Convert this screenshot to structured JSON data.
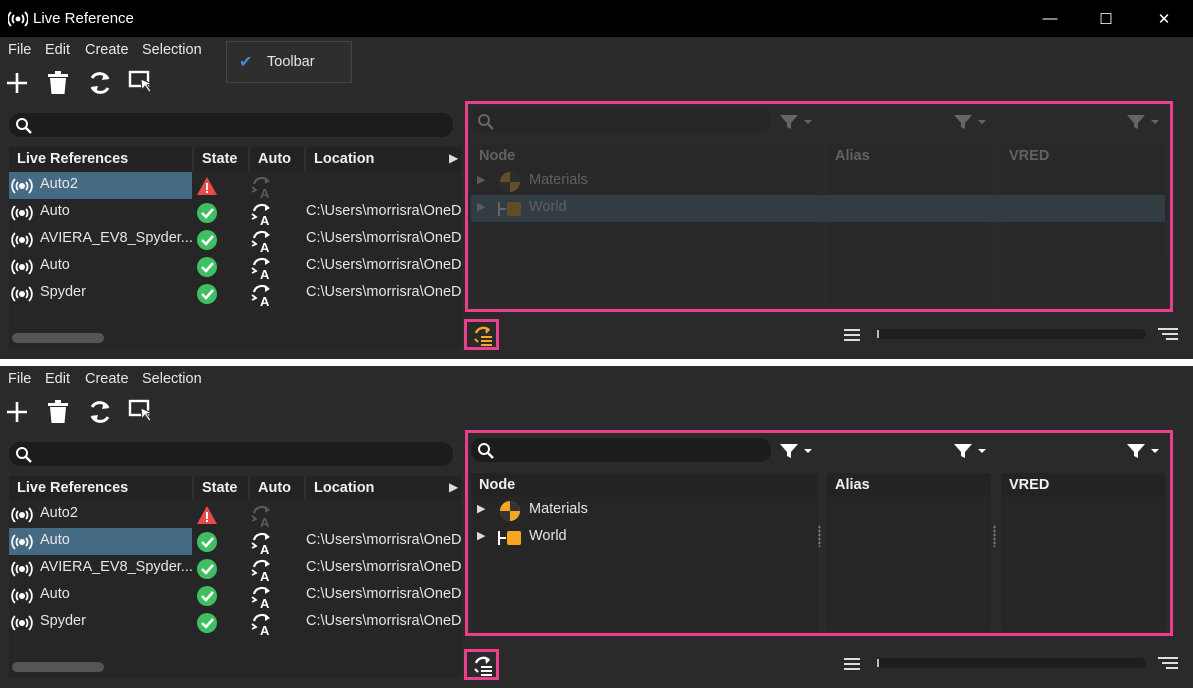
{
  "window": {
    "title": "Live Reference",
    "controls": [
      "—",
      "☐",
      "✕"
    ]
  },
  "menu": {
    "items": [
      "File",
      "Edit",
      "Create",
      "Selection"
    ]
  },
  "toolbar_dropdown": {
    "item_label": "Toolbar",
    "checked": true
  },
  "table": {
    "headers": {
      "name": "Live References",
      "state": "State",
      "auto": "Auto",
      "location": "Location"
    },
    "rows": [
      {
        "name": "Auto2",
        "state": "warning",
        "auto": "disabled",
        "location": ""
      },
      {
        "name": "Auto",
        "state": "ok",
        "auto": "enabled",
        "location": "C:\\Users\\morrisra\\OneD"
      },
      {
        "name": "AVIERA_EV8_Spyder...",
        "state": "ok",
        "auto": "enabled",
        "location": "C:\\Users\\morrisra\\OneD"
      },
      {
        "name": "Auto",
        "state": "ok",
        "auto": "enabled",
        "location": "C:\\Users\\morrisra\\OneD"
      },
      {
        "name": "Spyder",
        "state": "ok",
        "auto": "enabled",
        "location": "C:\\Users\\morrisra\\OneD"
      }
    ]
  },
  "tree": {
    "columns": {
      "node": "Node",
      "alias": "Alias",
      "vred": "VRED"
    },
    "nodes": [
      {
        "label": "Materials",
        "icon": "materials-icon"
      },
      {
        "label": "World",
        "icon": "world-icon"
      }
    ]
  },
  "colors": {
    "highlight": "#e8408c",
    "selection": "#456a83",
    "ok": "#3fbf62",
    "warning": "#e84a4a",
    "accent": "#f5a623"
  },
  "panels": {
    "top": {
      "selected_row": 0,
      "tree_dimmed": true,
      "world_selected": true
    },
    "bottom": {
      "selected_row": 1,
      "tree_dimmed": false,
      "world_selected": false
    }
  }
}
